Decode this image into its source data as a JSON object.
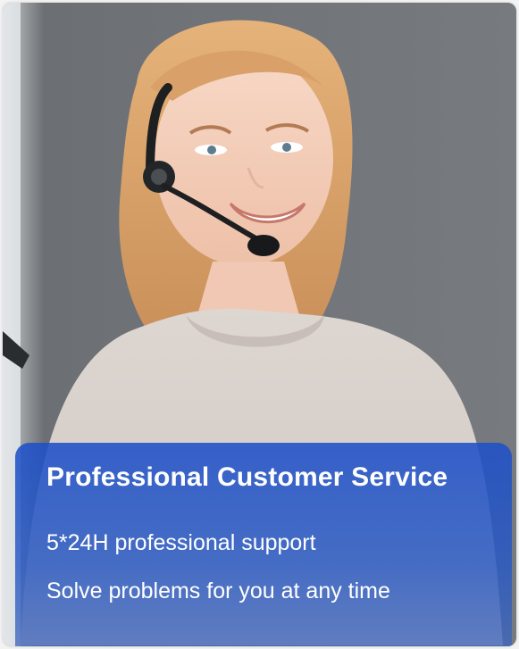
{
  "banner": {
    "title": "Professional Customer Service",
    "lines": [
      "5*24H professional support",
      "Solve problems for you at any time"
    ]
  },
  "colors": {
    "overlay": "#2a5ac6",
    "text": "#ffffff"
  },
  "photo": {
    "subject": "smiling woman wearing headset"
  }
}
